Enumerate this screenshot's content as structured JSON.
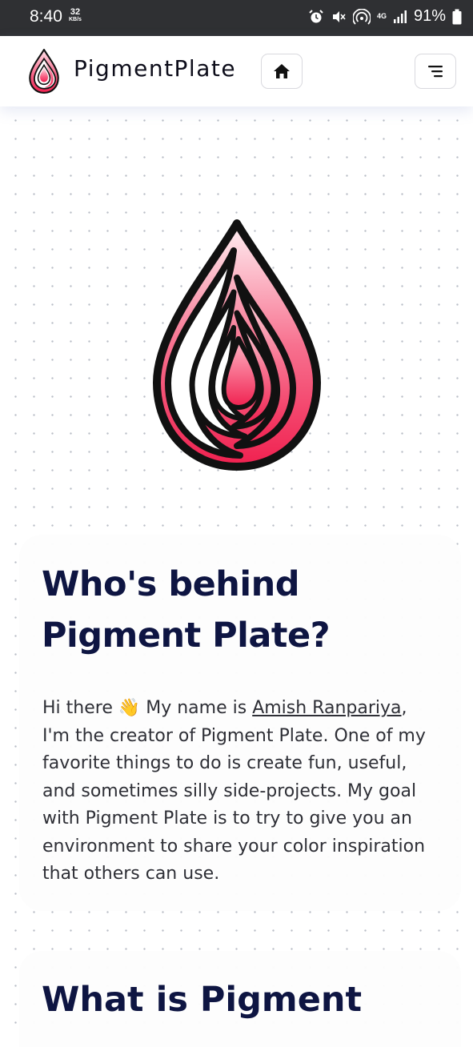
{
  "status_bar": {
    "time": "8:40",
    "data_speed": "32",
    "data_speed_unit": "KB/s",
    "network": "4G",
    "battery": "91%"
  },
  "navbar": {
    "brand": "PigmentPlate",
    "home_icon": "home-icon",
    "menu_icon": "menu-icon"
  },
  "about": {
    "title": "Who's behind Pigment Plate?",
    "intro": "Hi there 👋 My name is ",
    "author_link": "Amish Ranpariya",
    "body": ", I'm the creator of Pigment Plate. One of my favorite things to do is create fun, useful, and sometimes silly side-projects. My goal with Pigment Plate is to try to give you an environment to share your color inspiration that others can use."
  },
  "next_section": {
    "title": "What is Pigment"
  },
  "colors": {
    "brand_red": "#f0204f",
    "brand_pink": "#ffe3ea",
    "heading_navy": "#0e1542",
    "status_bar_bg": "#2f3033"
  }
}
